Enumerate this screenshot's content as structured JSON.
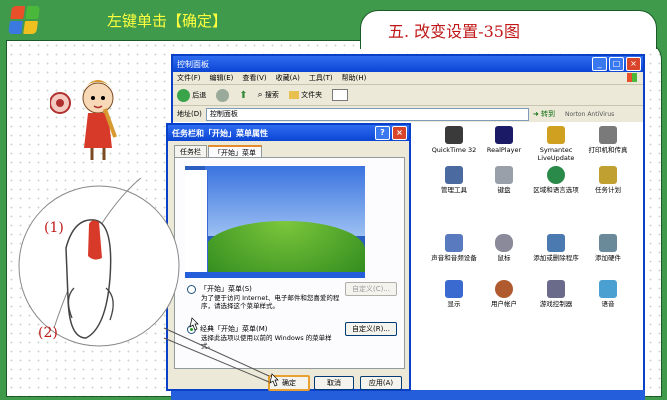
{
  "slide": {
    "hint": "左键单击【确定】",
    "title": "五. 改变设置-35图",
    "label_1": "(1)",
    "label_2": "(2)"
  },
  "window": {
    "title": "控制面板",
    "menu": [
      "文件(F)",
      "编辑(E)",
      "查看(V)",
      "收藏(A)",
      "工具(T)",
      "帮助(H)"
    ],
    "toolbar": {
      "back": "后退",
      "search": "搜索",
      "folders": "文件夹"
    },
    "address_label": "地址(D)",
    "address_value": "控制面板",
    "go": "转到",
    "norton": "Norton AntiVirus"
  },
  "icons": [
    {
      "label": "QuickTime 32",
      "color": "#3a3a3a"
    },
    {
      "label": "RealPlayer",
      "color": "#1a1a66"
    },
    {
      "label": "Symantec LiveUpdate",
      "color": "#d0a020"
    },
    {
      "label": "打印机和传真",
      "color": "#7a7a7a"
    },
    {
      "label": "管理工具",
      "color": "#4a6aa0"
    },
    {
      "label": "键盘",
      "color": "#9aa0aa"
    },
    {
      "label": "区域和语言选项",
      "color": "#2a8a4a"
    },
    {
      "label": "任务计划",
      "color": "#c0a030"
    },
    {
      "label": "声音和音频设备",
      "color": "#5a7ac0"
    },
    {
      "label": "鼠标",
      "color": "#8a8a9a"
    },
    {
      "label": "添加或删除程序",
      "color": "#4a7ab0"
    },
    {
      "label": "添加硬件",
      "color": "#6a8a9a"
    },
    {
      "label": "显示",
      "color": "#3a6ad0"
    },
    {
      "label": "用户帐户",
      "color": "#b05a30"
    },
    {
      "label": "游戏控制器",
      "color": "#6a6a8a"
    },
    {
      "label": "语音",
      "color": "#4aa0d0"
    }
  ],
  "dialog": {
    "title": "任务栏和「开始」菜单属性",
    "tabs": [
      "任务栏",
      "「开始」菜单"
    ],
    "option_start": "「开始」菜单(S)",
    "option_start_desc": "为了便于访问 Internet、电子邮件和您喜爱的程序，请选择这个菜单样式。",
    "customize_disabled": "自定义(C)...",
    "option_classic": "经典「开始」菜单(M)",
    "option_classic_desc": "选择此选项以使用以前的 Windows 的菜单样式。",
    "customize": "自定义(R)...",
    "ok": "确定",
    "cancel": "取消",
    "apply": "应用(A)"
  },
  "colors": {
    "slide_bg": "#3f9a4b",
    "title_red": "#c01818",
    "hint_yellow": "#ffff40",
    "xp_blue": "#0a3fc8"
  }
}
